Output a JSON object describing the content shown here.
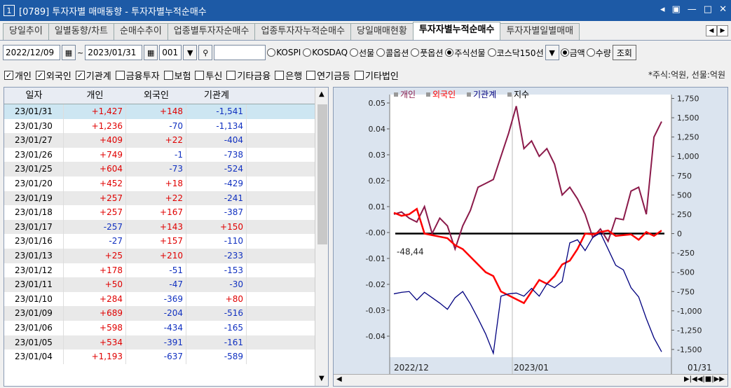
{
  "window": {
    "num": "1",
    "title": "[0789] 투자자별 매매동향 - 투자자별누적순매수"
  },
  "tabs": [
    "당일추이",
    "일별동향/차트",
    "순매수추이",
    "업종별투자자순매수",
    "업종투자자누적순매수",
    "당일매매현황",
    "투자자별누적순매수",
    "투자자별일별매매"
  ],
  "toolbar": {
    "start_date": "2022/12/09",
    "end_date": "2023/01/31",
    "code": "001",
    "markets": [
      "KOSPI",
      "KOSDAQ",
      "선물",
      "콜옵션",
      "풋옵션",
      "주식선물",
      "코스닥150선"
    ],
    "selected_market": "주식선물",
    "amount": "금액",
    "qty": "수량",
    "query": "조회"
  },
  "checks": [
    {
      "label": "개인",
      "on": true
    },
    {
      "label": "외국인",
      "on": true
    },
    {
      "label": "기관계",
      "on": true
    },
    {
      "label": "금융투자",
      "on": false
    },
    {
      "label": "보험",
      "on": false
    },
    {
      "label": "투신",
      "on": false
    },
    {
      "label": "기타금융",
      "on": false
    },
    {
      "label": "은행",
      "on": false
    },
    {
      "label": "연기금등",
      "on": false
    },
    {
      "label": "기타법인",
      "on": false
    }
  ],
  "unit_note": "*주식:억원, 선물:억원",
  "table": {
    "headers": [
      "일자",
      "개인",
      "외국인",
      "기관계"
    ],
    "rows": [
      [
        "23/01/31",
        "+1,427",
        "+148",
        "-1,541"
      ],
      [
        "23/01/30",
        "+1,236",
        "-70",
        "-1,134"
      ],
      [
        "23/01/27",
        "+409",
        "+22",
        "-404"
      ],
      [
        "23/01/26",
        "+749",
        "-1",
        "-738"
      ],
      [
        "23/01/25",
        "+604",
        "-73",
        "-524"
      ],
      [
        "23/01/20",
        "+452",
        "+18",
        "-429"
      ],
      [
        "23/01/19",
        "+257",
        "+22",
        "-241"
      ],
      [
        "23/01/18",
        "+257",
        "+167",
        "-387"
      ],
      [
        "23/01/17",
        "-257",
        "+143",
        "+150"
      ],
      [
        "23/01/16",
        "-27",
        "+157",
        "-110"
      ],
      [
        "23/01/13",
        "+25",
        "+210",
        "-233"
      ],
      [
        "23/01/12",
        "+178",
        "-51",
        "-153"
      ],
      [
        "23/01/11",
        "+50",
        "-47",
        "-30"
      ],
      [
        "23/01/10",
        "+284",
        "-369",
        "+80"
      ],
      [
        "23/01/09",
        "+689",
        "-204",
        "-516"
      ],
      [
        "23/01/06",
        "+598",
        "-434",
        "-165"
      ],
      [
        "23/01/05",
        "+534",
        "-391",
        "-161"
      ],
      [
        "23/01/04",
        "+1,193",
        "-637",
        "-589"
      ]
    ]
  },
  "chart_data": {
    "type": "line",
    "legend": [
      {
        "name": "개인",
        "color": "#8b1a4a"
      },
      {
        "name": "외국인",
        "color": "#ff0000"
      },
      {
        "name": "기관계",
        "color": "#00007f"
      },
      {
        "name": "지수",
        "color": "#000000"
      }
    ],
    "left_ticks": [
      "0.05",
      "0.04",
      "0.03",
      "0.02",
      "0.01",
      "-0.00",
      "-0.01",
      "-0.02",
      "-0.03",
      "-0.04"
    ],
    "right_ticks": [
      "1,750",
      "1,500",
      "1,250",
      "1,000",
      "750",
      "500",
      "250",
      "0",
      "-250",
      "-500",
      "-750",
      "-1,000",
      "-1,250",
      "-1,500"
    ],
    "x_labels": [
      "2022/12",
      "2023/01",
      "01/31"
    ],
    "value_label": "-48,44",
    "ylim_right": [
      -1600,
      1800
    ],
    "series": [
      {
        "name": "개인",
        "values": [
          250,
          280,
          200,
          150,
          350,
          0,
          200,
          100,
          -200,
          100,
          300,
          600,
          650,
          700,
          1000,
          1300,
          1650,
          1100,
          1200,
          1000,
          1100,
          900,
          500,
          600,
          450,
          250,
          -50,
          60,
          -100,
          200,
          180,
          550,
          600,
          250,
          1250,
          1450
        ]
      },
      {
        "name": "외국인",
        "values": [
          270,
          230,
          250,
          320,
          0,
          -20,
          -40,
          -60,
          -150,
          -200,
          -300,
          -400,
          -500,
          -550,
          -750,
          -800,
          -850,
          -900,
          -750,
          -600,
          -650,
          -550,
          -400,
          -350,
          -200,
          0,
          -10,
          20,
          40,
          -30,
          -20,
          -10,
          -80,
          20,
          -30,
          40
        ]
      },
      {
        "name": "기관계",
        "values": [
          -780,
          -760,
          -750,
          -860,
          -760,
          -830,
          -900,
          -980,
          -830,
          -750,
          -910,
          -1100,
          -1300,
          -1550,
          -810,
          -780,
          -770,
          -810,
          -710,
          -810,
          -650,
          -700,
          -620,
          -120,
          -80,
          -220,
          -50,
          10,
          -200,
          -410,
          -470,
          -700,
          -820,
          -1100,
          -1350,
          -1530
        ]
      }
    ]
  }
}
